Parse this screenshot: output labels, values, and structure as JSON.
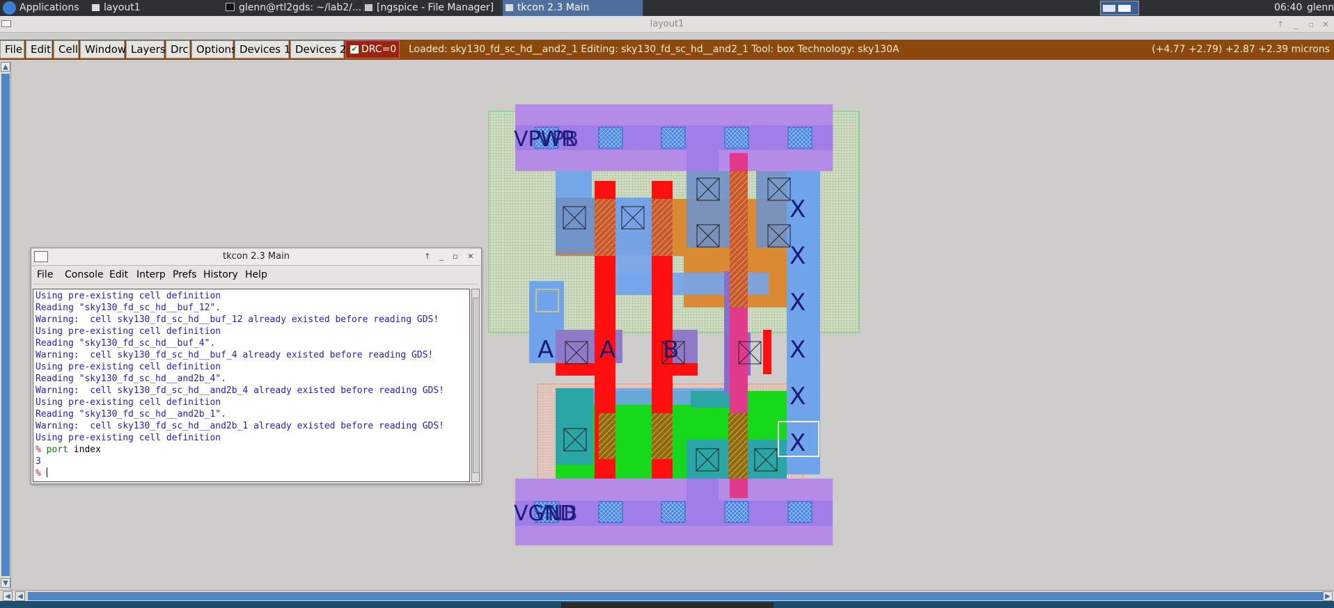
{
  "taskbar": {
    "apps_label": "Applications",
    "tasks": [
      {
        "label": "layout1",
        "icon": "window-icon"
      },
      {
        "label": "glenn@rtl2gds: ~/lab2/...",
        "icon": "terminal-icon"
      },
      {
        "label": "[ngspice - File Manager]",
        "icon": "folder-icon"
      },
      {
        "label": "tkcon 2.3 Main",
        "icon": "window-icon"
      }
    ],
    "clock": "06:40",
    "user": "glenn"
  },
  "window": {
    "title": "layout1"
  },
  "menubar": {
    "items": [
      "File",
      "Edit",
      "Cell",
      "Window",
      "Layers",
      "Drc",
      "Options",
      "Devices 1",
      "Devices 2"
    ],
    "drc_label": "DRC=0",
    "status": "Loaded: sky130_fd_sc_hd__and2_1 Editing: sky130_fd_sc_hd__and2_1 Tool: box  Technology: sky130A",
    "coords": "(+4.77 +2.79) +2.87 +2.39 microns"
  },
  "layout": {
    "cell_name": "sky130_fd_sc_hd__and2_1",
    "power_label": "VPWR",
    "power_label_2": "VPB",
    "ground_label": "VGND",
    "ground_label_2": "VNB",
    "input_a": "A",
    "input_b": "B",
    "output_x": "X",
    "colors": {
      "background": "#cfcdcb",
      "metal1": "#7fa7e6",
      "li1": "#9c64c9",
      "poly": "#ff1010",
      "pdiff": "#d07a2a",
      "ndiff": "#12d81a",
      "met_contact": "#4e88e0",
      "nwell": "#9bd78f"
    }
  },
  "tkcon": {
    "title": "tkcon 2.3 Main",
    "menu": [
      "File",
      "Console",
      "Edit",
      "Interp",
      "Prefs",
      "History",
      "Help"
    ],
    "lines": [
      {
        "text": "Using pre-existing cell definition",
        "cls": "c-blue"
      },
      {
        "text": "Reading \"sky130_fd_sc_hd__buf_12\".",
        "cls": "c-blue"
      },
      {
        "text": "Warning:  cell sky130_fd_sc_hd__buf_12 already existed before reading GDS!",
        "cls": "c-blue"
      },
      {
        "text": "Using pre-existing cell definition",
        "cls": "c-blue"
      },
      {
        "text": "Reading \"sky130_fd_sc_hd__buf_4\".",
        "cls": "c-blue"
      },
      {
        "text": "Warning:  cell sky130_fd_sc_hd__buf_4 already existed before reading GDS!",
        "cls": "c-blue"
      },
      {
        "text": "Using pre-existing cell definition",
        "cls": "c-blue"
      },
      {
        "text": "Reading \"sky130_fd_sc_hd__and2b_4\".",
        "cls": "c-blue"
      },
      {
        "text": "Warning:  cell sky130_fd_sc_hd__and2b_4 already existed before reading GDS!",
        "cls": "c-blue"
      },
      {
        "text": "Using pre-existing cell definition",
        "cls": "c-blue"
      },
      {
        "text": "Reading \"sky130_fd_sc_hd__and2b_1\".",
        "cls": "c-blue"
      },
      {
        "text": "Warning:  cell sky130_fd_sc_hd__and2b_1 already existed before reading GDS!",
        "cls": "c-blue"
      },
      {
        "text": "Using pre-existing cell definition",
        "cls": "c-blue"
      }
    ],
    "prompt_symbol": "%",
    "command_keyword": "port",
    "command_arg": " index",
    "result": "3"
  }
}
